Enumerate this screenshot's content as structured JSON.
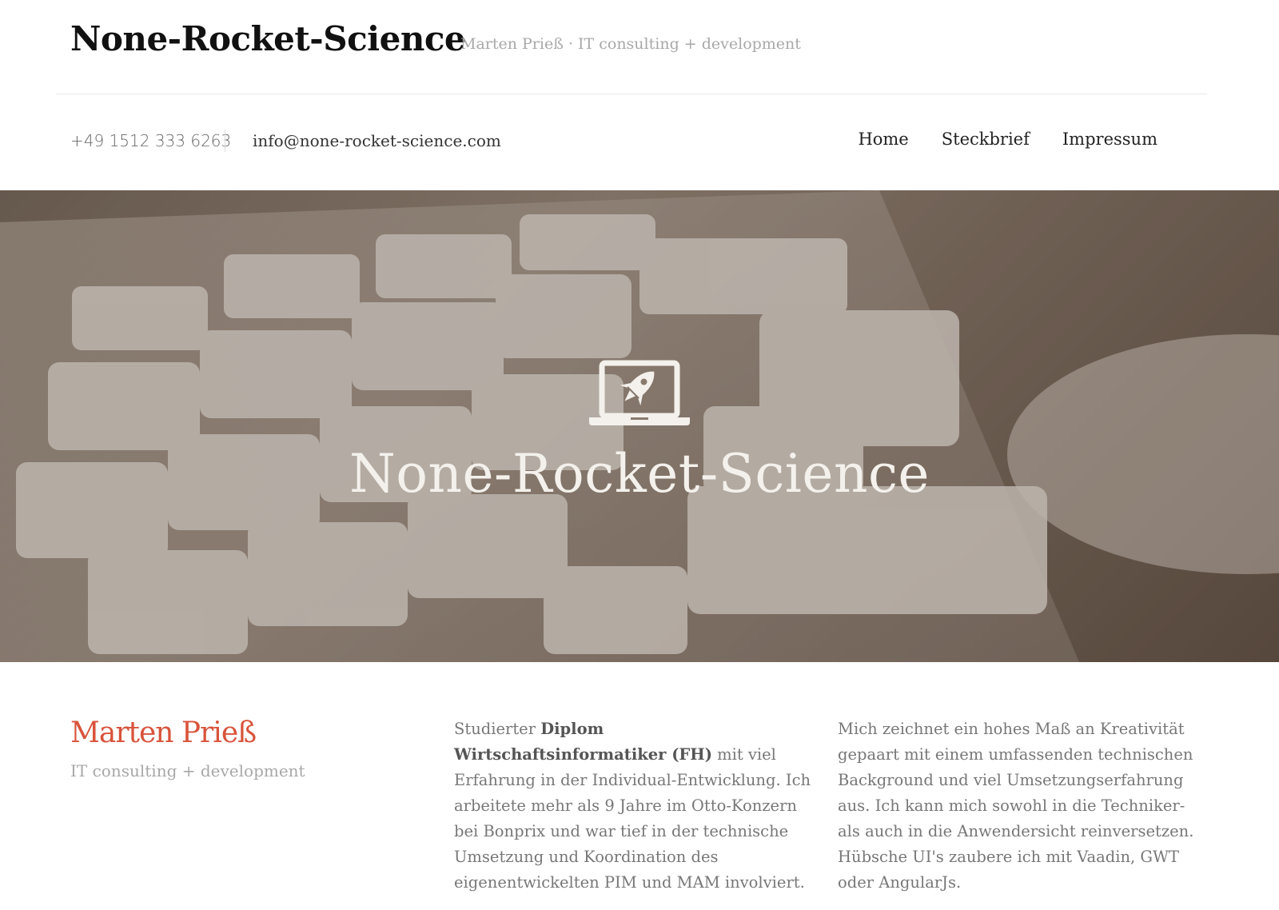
{
  "header": {
    "site_title": "None-Rocket-Science",
    "tagline": "Marten Prieß · IT consulting + development"
  },
  "contact": {
    "phone": "+49 1512 333 6263",
    "email": "info@none-rocket-science.com"
  },
  "nav": {
    "items": [
      {
        "label": "Home"
      },
      {
        "label": "Steckbrief"
      },
      {
        "label": "Impressum"
      }
    ]
  },
  "hero": {
    "logo_icon": "laptop-rocket-icon",
    "title": "None-Rocket-Science"
  },
  "about": {
    "name": "Marten Prieß",
    "subtitle": "IT consulting + development",
    "col1_prefix": "Studierter ",
    "col1_bold": "Diplom Wirtschaftsinformatiker (FH)",
    "col1_rest": " mit viel Erfahrung in der Individual-Entwicklung. Ich arbeitete mehr als 9 Jahre im Otto-Konzern bei Bonprix und war tief in der technische Umsetzung und Koordination des eigenentwickelten PIM und MAM involviert.",
    "col2_text": "Mich zeichnet ein hohes Maß an Kreativität gepaart mit einem umfassenden technischen Background und viel Umsetzungserfahrung aus. Ich kann mich sowohl in die Techniker- als auch in die Anwendersicht reinversetzen. Hübsche UI's zaubere ich mit Vaadin, GWT oder AngularJs."
  },
  "colors": {
    "accent": "#d9533b",
    "muted": "#a8a8a8"
  }
}
